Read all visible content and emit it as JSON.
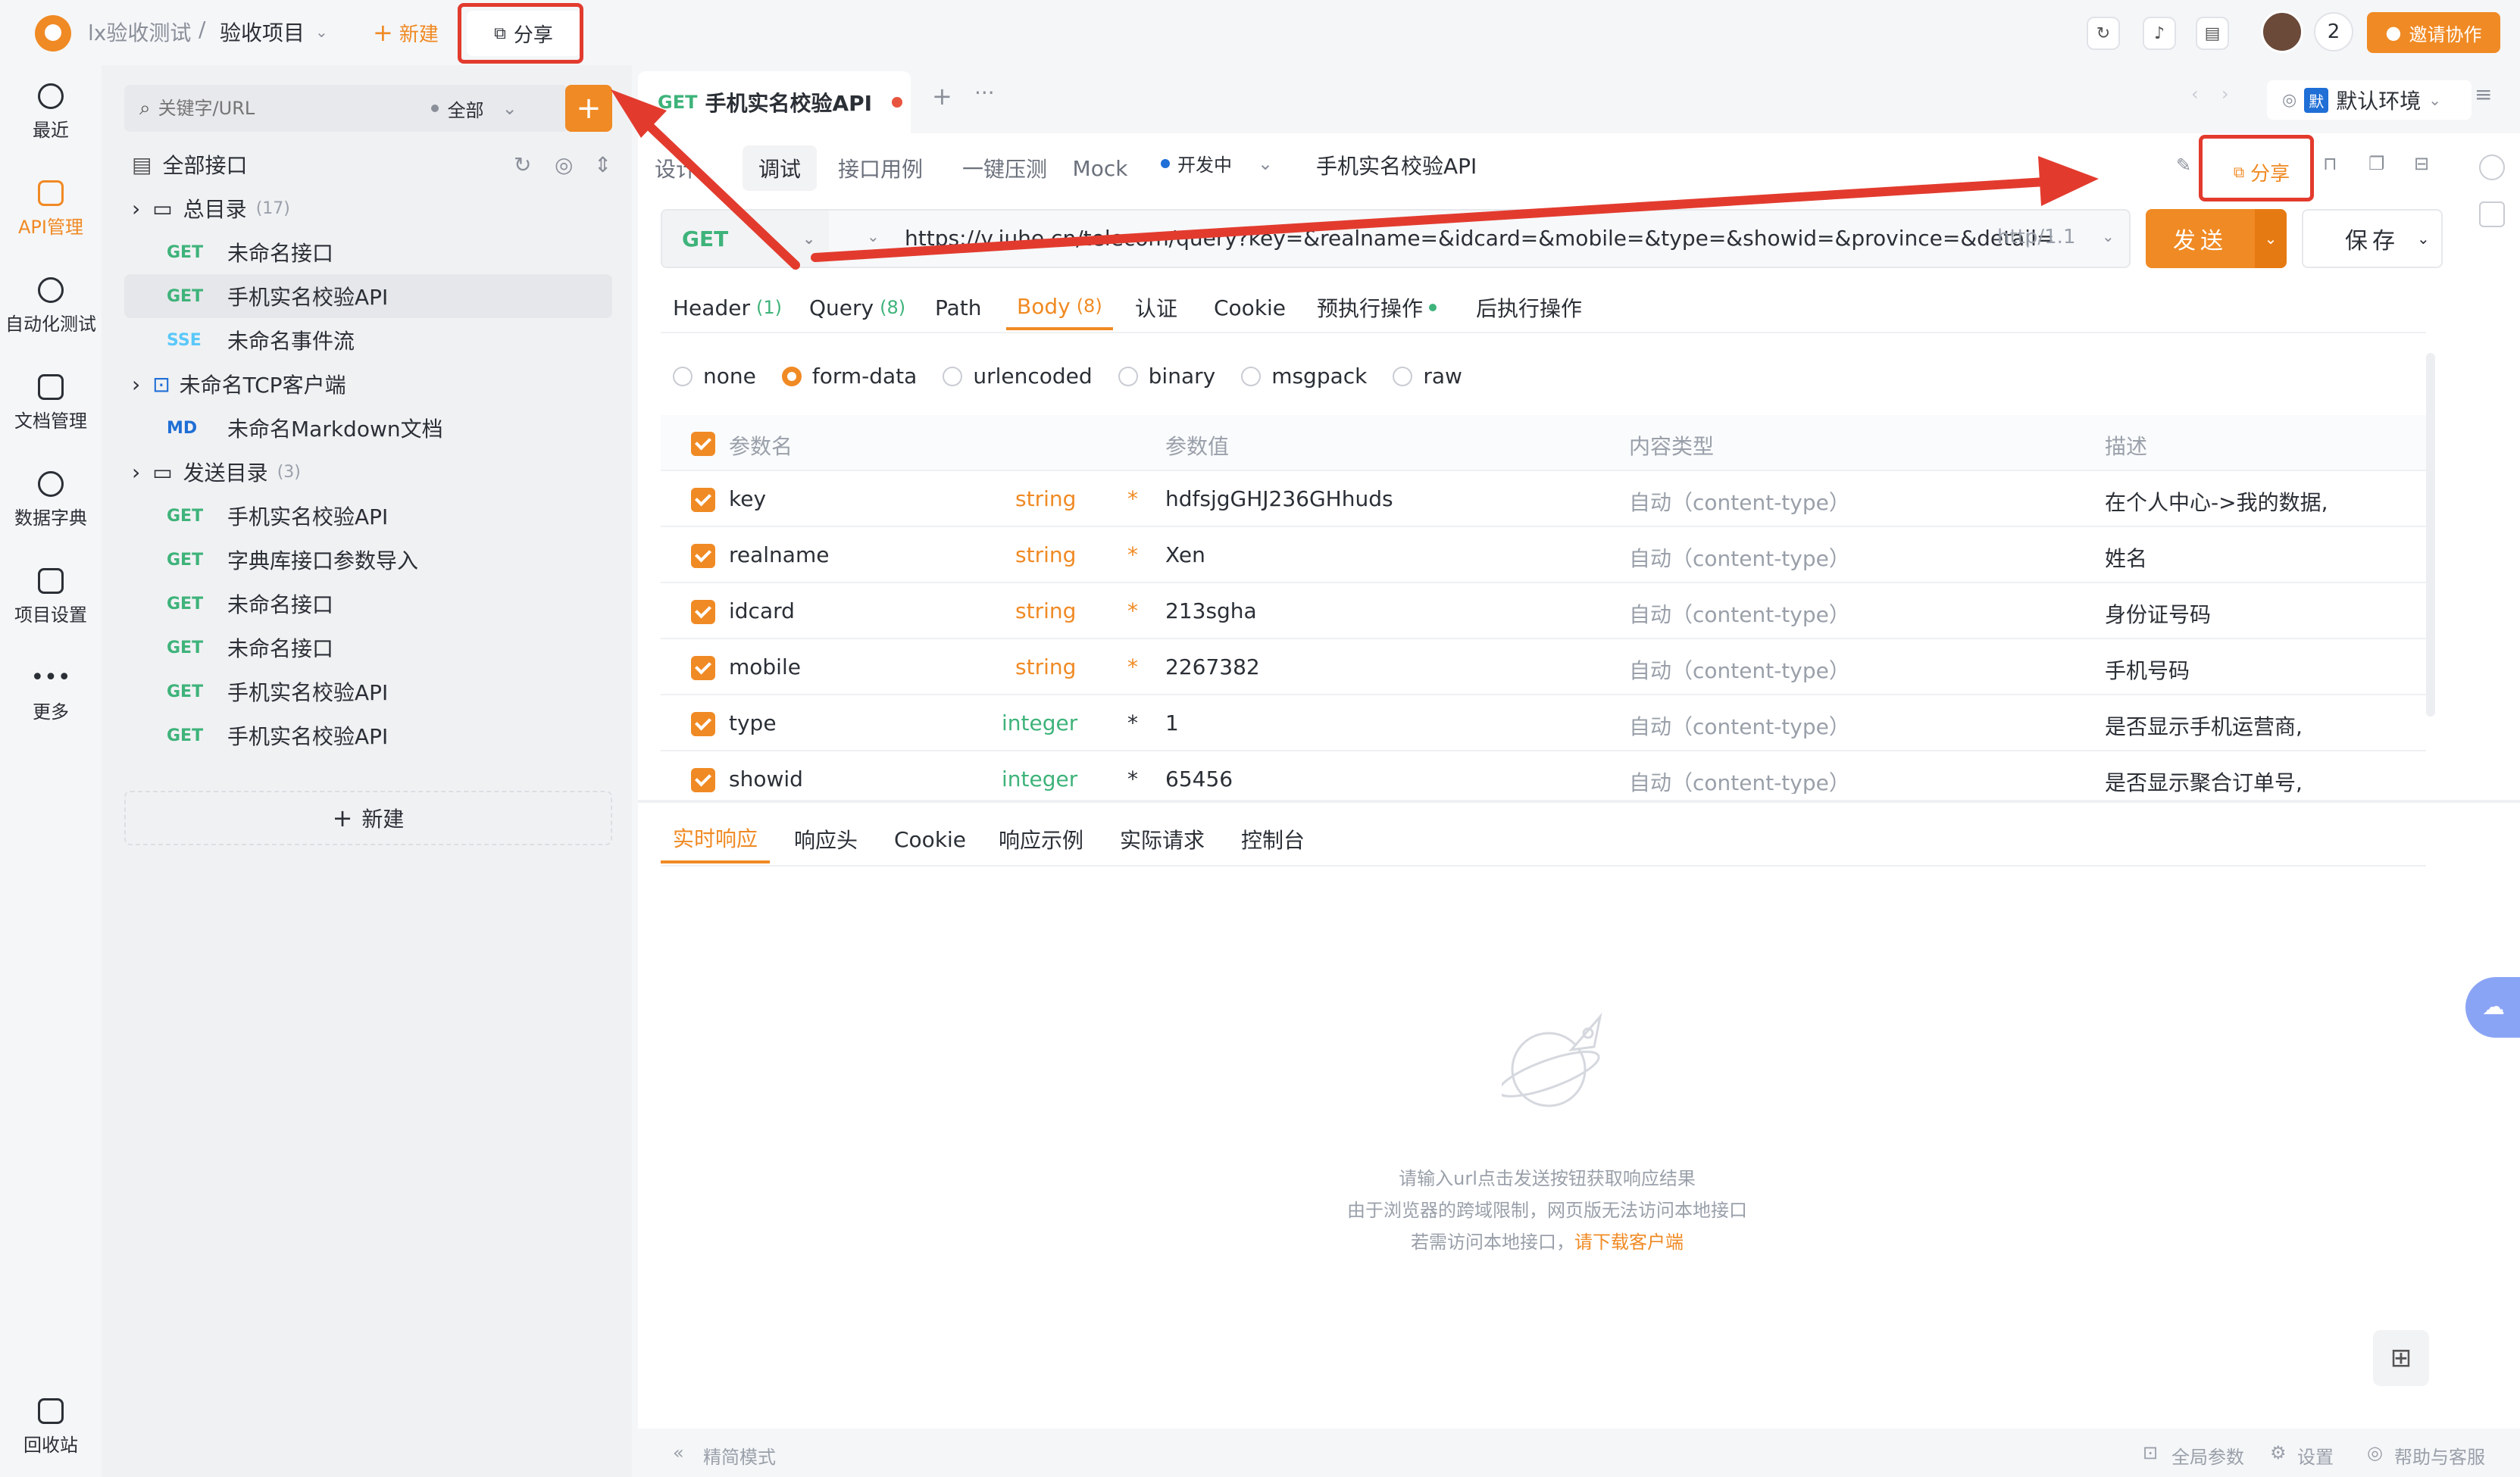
{
  "topbar": {
    "team": "lx验收测试",
    "separator": "/",
    "project": "验收项目",
    "new_label": "新建",
    "share_label": "分享",
    "avatar_count": "2",
    "invite_label": "邀请协作"
  },
  "leftnav": {
    "items": [
      {
        "label": "最近"
      },
      {
        "label": "API管理"
      },
      {
        "label": "自动化测试"
      },
      {
        "label": "文档管理"
      },
      {
        "label": "数据字典"
      },
      {
        "label": "项目设置"
      },
      {
        "label": "更多"
      }
    ],
    "trash_label": "回收站"
  },
  "sidebar": {
    "search_placeholder": "关键字/URL",
    "filter_label": "全部",
    "all_label": "全部接口",
    "tree": [
      {
        "kind": "folder",
        "name": "总目录",
        "count": "(17)"
      },
      {
        "method": "GET",
        "name": "未命名接口"
      },
      {
        "method": "GET",
        "name": "手机实名校验API"
      },
      {
        "method": "SSE",
        "name": "未命名事件流"
      },
      {
        "kind": "tcp",
        "name": "未命名TCP客户端"
      },
      {
        "method": "MD",
        "name": "未命名Markdown文档"
      },
      {
        "kind": "folder",
        "name": "发送目录",
        "count": "(3)"
      },
      {
        "method": "GET",
        "name": "手机实名校验API"
      },
      {
        "method": "GET",
        "name": "字典库接口参数导入"
      },
      {
        "method": "GET",
        "name": "未命名接口"
      },
      {
        "method": "GET",
        "name": "未命名接口"
      },
      {
        "method": "GET",
        "name": "手机实名校验API"
      },
      {
        "method": "GET",
        "name": "手机实名校验API"
      }
    ],
    "new_label": "新建"
  },
  "tabs": {
    "active": {
      "method": "GET",
      "title": "手机实名校验API"
    },
    "env_badge": "默",
    "env_label": "默认环境"
  },
  "editor": {
    "subtabs": [
      "设计",
      "调试",
      "接口用例",
      "一键压测",
      "Mock"
    ],
    "status": "开发中",
    "api_name": "手机实名校验API",
    "share_label": "分享",
    "method": "GET",
    "url": "https://v.juhe.cn/telecom/query?key=&realname=&idcard=&mobile=&type=&showid=&province=&detail=",
    "protocol": "http/1.1",
    "send_label": "发送",
    "save_label": "保存",
    "param_tabs": [
      {
        "label": "Header",
        "count": "(1)"
      },
      {
        "label": "Query",
        "count": "(8)"
      },
      {
        "label": "Path",
        "count": ""
      },
      {
        "label": "Body",
        "count": "(8)"
      },
      {
        "label": "认证",
        "count": ""
      },
      {
        "label": "Cookie",
        "count": ""
      },
      {
        "label": "预执行操作",
        "count": ""
      },
      {
        "label": "后执行操作",
        "count": ""
      }
    ],
    "body_types": [
      "none",
      "form-data",
      "urlencoded",
      "binary",
      "msgpack",
      "raw"
    ],
    "table_headers": [
      "参数名",
      "参数值",
      "内容类型",
      "描述"
    ],
    "params": [
      {
        "name": "key",
        "type": "string",
        "value": "hdfsjgGHJ236GHhuds",
        "ctype": "自动（content-type）",
        "desc": "在个人中心->我的数据,"
      },
      {
        "name": "realname",
        "type": "string",
        "value": "Xen",
        "ctype": "自动（content-type）",
        "desc": "姓名"
      },
      {
        "name": "idcard",
        "type": "string",
        "value": "213sgha",
        "ctype": "自动（content-type）",
        "desc": "身份证号码"
      },
      {
        "name": "mobile",
        "type": "string",
        "value": "2267382",
        "ctype": "自动（content-type）",
        "desc": "手机号码"
      },
      {
        "name": "type",
        "type": "integer",
        "value": "1",
        "ctype": "自动（content-type）",
        "desc": "是否显示手机运营商,"
      },
      {
        "name": "showid",
        "type": "integer",
        "value": "65456",
        "ctype": "自动（content-type）",
        "desc": "是否显示聚合订单号,"
      }
    ]
  },
  "response": {
    "tabs": [
      "实时响应",
      "响应头",
      "Cookie",
      "响应示例",
      "实际请求",
      "控制台"
    ],
    "empty_line1": "请输入url点击发送按钮获取响应结果",
    "empty_line2": "由于浏览器的跨域限制，网页版无法访问本地接口",
    "empty_line3_prefix": "若需访问本地接口，",
    "empty_line3_link": "请下载客户端"
  },
  "footer": {
    "simple_mode": "精简模式",
    "global_params": "全局参数",
    "settings": "设置",
    "help": "帮助与客服"
  },
  "colors": {
    "accent": "#f08a24",
    "get": "#3eb37a",
    "annotation": "#e23b2e"
  }
}
